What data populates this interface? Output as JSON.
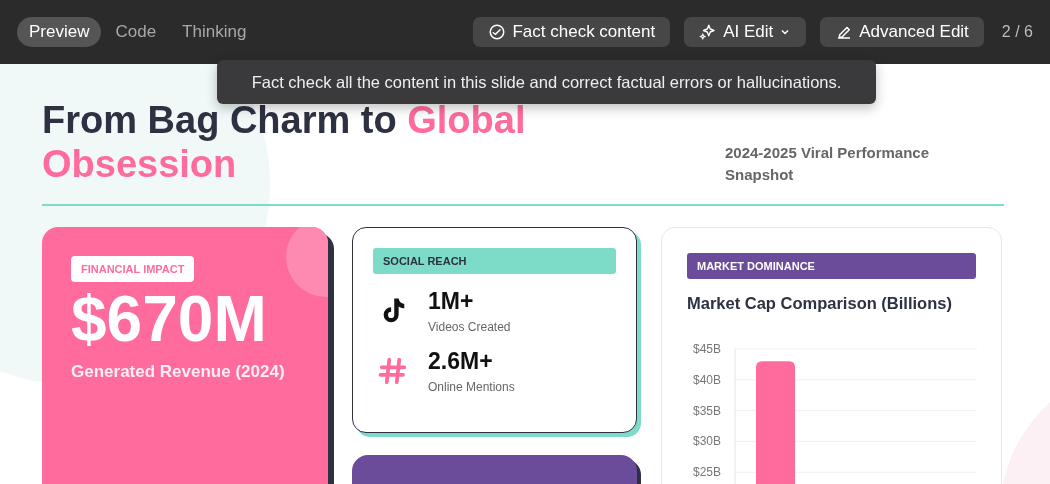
{
  "toolbar": {
    "tabs": [
      {
        "label": "Preview",
        "selected": true
      },
      {
        "label": "Code",
        "selected": false
      },
      {
        "label": "Thinking",
        "selected": false
      }
    ],
    "buttons": [
      {
        "label": "Fact check content",
        "kind": "check"
      },
      {
        "label": "AI Edit",
        "kind": "ai"
      },
      {
        "label": "Advanced Edit",
        "kind": "edit"
      }
    ],
    "page_counter": "2 / 6",
    "tooltip": "Fact check all the content in this slide and correct factual errors or hallucinations."
  },
  "slide": {
    "title": "From Bag Charm to",
    "title_accent": "Global Obsession",
    "subtitle": "2024-2025 Viral Performance Snapshot",
    "financial": {
      "tag": "FINANCIAL IMPACT",
      "value": "$670M",
      "caption": "Generated Revenue (2024)"
    },
    "social": {
      "tag": "SOCIAL REACH",
      "stats": [
        {
          "kind": "video",
          "value": "1M+",
          "label": "Videos Created"
        },
        {
          "kind": "hashtag",
          "value": "2.6M+",
          "label": "Online Mentions"
        }
      ]
    },
    "market": {
      "tag": "MARKET DOMINANCE",
      "chart_title": "Market Cap Comparison (Billions)",
      "chart_data": {
        "type": "bar",
        "values": [
          43
        ],
        "ylim": [
          0,
          45
        ],
        "grid": true,
        "yticks": [
          {
            "value": 25,
            "label": "$25B"
          },
          {
            "value": 30,
            "label": "$30B"
          },
          {
            "value": 35,
            "label": "$35B"
          },
          {
            "value": 40,
            "label": "$40B"
          },
          {
            "value": 45,
            "label": "$45B"
          }
        ]
      }
    }
  }
}
